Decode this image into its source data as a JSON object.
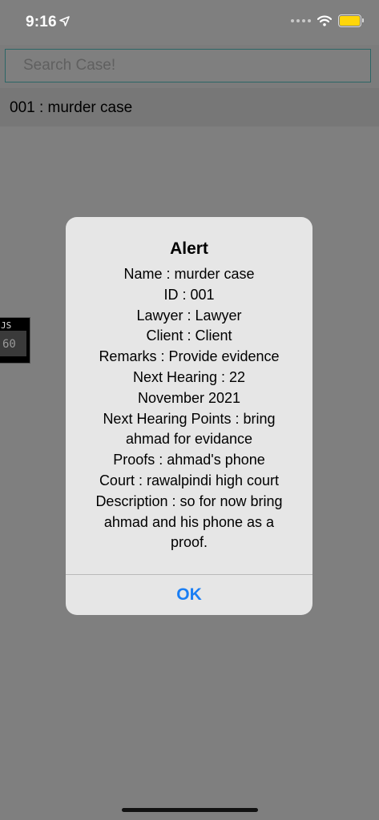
{
  "status_bar": {
    "time": "9:16",
    "battery_color": "#ffd60a",
    "icons": [
      "location-arrow-icon",
      "signal-dots-icon",
      "wifi-icon",
      "battery-icon"
    ]
  },
  "search": {
    "placeholder": "Search Case!",
    "value": ""
  },
  "list": {
    "items": [
      {
        "label": "001 : murder case"
      }
    ]
  },
  "floating_widget": {
    "label_top": "JS",
    "label_value": "60"
  },
  "alert": {
    "title": "Alert",
    "lines": [
      "Name : murder case",
      "ID : 001",
      "Lawyer : Lawyer",
      "Client : Client",
      "Remarks : Provide evidence",
      "Next Hearing : 22",
      "November 2021",
      "Next Hearing Points : bring",
      "ahmad for evidance",
      "Proofs : ahmad's phone",
      "Court : rawalpindi high court",
      "Description : so for now bring",
      "ahmad and his phone as a",
      "proof."
    ],
    "ok_label": "OK",
    "accent_color": "#1a7ef4"
  }
}
